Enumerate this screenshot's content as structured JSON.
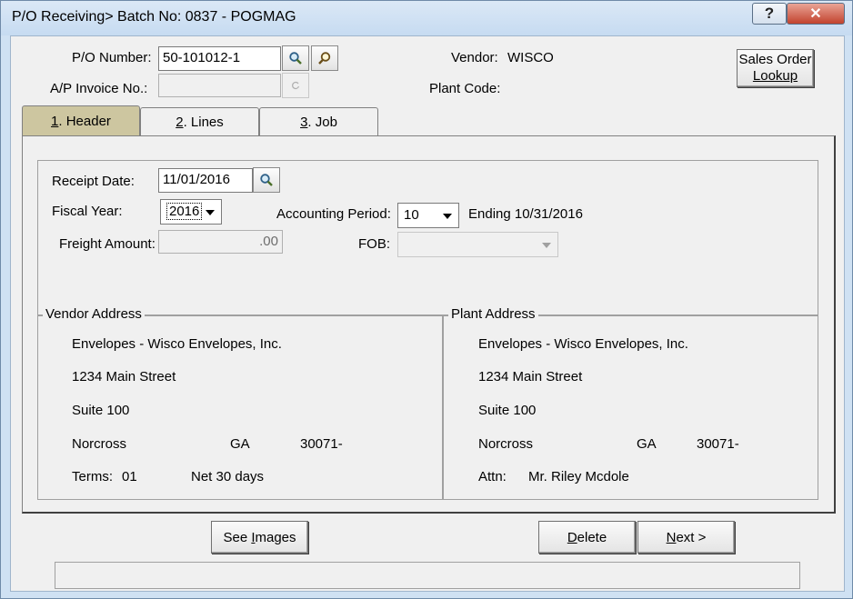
{
  "window": {
    "title": "P/O Receiving> Batch No: 0837 - POGMAG",
    "help_label": "?",
    "close_label": "✕"
  },
  "header": {
    "po_number_label": "P/O Number:",
    "po_number_value": "50-101012-1",
    "ap_invoice_label": "A/P Invoice No.:",
    "ap_invoice_value": "",
    "vendor_label": "Vendor:",
    "vendor_value": "WISCO",
    "plant_code_label": "Plant Code:",
    "plant_code_value": "",
    "sales_order_lookup_line1": "Sales Order",
    "sales_order_lookup_line2": "Lookup"
  },
  "tabs": [
    {
      "label": "1. Header",
      "hotkey": "1",
      "rest": ". Header",
      "active": true
    },
    {
      "label": "2. Lines",
      "hotkey": "2",
      "rest": ". Lines",
      "active": false
    },
    {
      "label": "3. Job",
      "hotkey": "3",
      "rest": ". Job",
      "active": false
    }
  ],
  "receipt": {
    "receipt_date_label": "Receipt Date:",
    "receipt_date_value": "11/01/2016",
    "fiscal_year_label": "Fiscal Year:",
    "fiscal_year_value": "2016",
    "accounting_period_label": "Accounting Period:",
    "accounting_period_value": "10",
    "ending_text": "Ending 10/31/2016",
    "freight_amount_label": "Freight Amount:",
    "freight_amount_value": ".00",
    "fob_label": "FOB:",
    "fob_value": ""
  },
  "vendor_address": {
    "legend": "Vendor Address",
    "name": "Envelopes - Wisco Envelopes, Inc.",
    "street": "1234 Main Street",
    "suite": "Suite 100",
    "city": "Norcross",
    "state": "GA",
    "zip": "30071-",
    "terms_label": "Terms:",
    "terms_code": "01",
    "terms_desc": "Net 30 days"
  },
  "plant_address": {
    "legend": "Plant Address",
    "name": "Envelopes - Wisco Envelopes, Inc.",
    "street": "1234 Main Street",
    "suite": "Suite 100",
    "city": "Norcross",
    "state": "GA",
    "zip": "30071-",
    "attn_label": "Attn:",
    "attn_value": "Mr. Riley Mcdole"
  },
  "footer": {
    "see_images_pre": "See ",
    "see_images_hot": "I",
    "see_images_post": "mages",
    "delete_hot": "D",
    "delete_post": "elete",
    "next_hot": "N",
    "next_post": "ext >",
    "status_text": ""
  },
  "icons": {
    "search": "magnifier-icon",
    "lookup": "zoom-icon"
  },
  "colors": {
    "title_bar": "#cfe1f3",
    "active_tab": "#cdc6a0",
    "close_button": "#c2432e",
    "form_background": "#f0f0f0"
  }
}
